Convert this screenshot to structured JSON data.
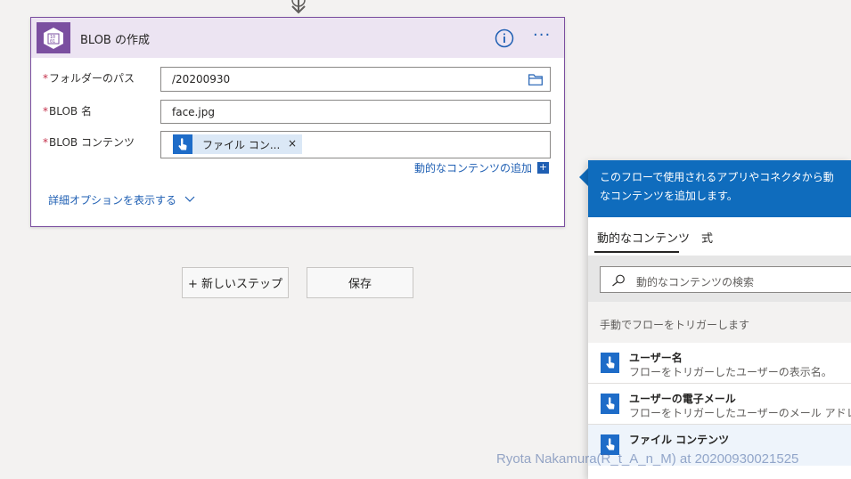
{
  "action_card": {
    "title": "BLOB の作成",
    "icon": "blob-storage-icon",
    "fields": [
      {
        "label": "フォルダーのパス",
        "value": "/20200930",
        "required_mark": "*"
      },
      {
        "label": "BLOB 名",
        "value": "face.jpg",
        "required_mark": "*"
      },
      {
        "label": "BLOB コンテンツ",
        "token_label": "ファイル コン...",
        "token_close": "×",
        "required_mark": "*"
      }
    ],
    "add_dynamic_content": "動的なコンテンツの追加",
    "show_advanced": "詳細オプションを表示する",
    "colors": {
      "accent": "#7b4fa0",
      "header_bg": "#ece4f2",
      "link": "#1f5fb3"
    }
  },
  "buttons": {
    "new_step": "+ 新しいステップ",
    "save": "保存"
  },
  "dynamic_panel": {
    "header_line1": "このフローで使用されるアプリやコネクタから動",
    "header_line2": "なコンテンツを追加します。",
    "tabs": [
      "動的なコンテンツ",
      "式"
    ],
    "search_placeholder": "動的なコンテンツの検索",
    "section_title": "手動でフローをトリガーします",
    "items": [
      {
        "title": "ユーザー名",
        "description": "フローをトリガーしたユーザーの表示名。"
      },
      {
        "title": "ユーザーの電子メール",
        "description": "フローをトリガーしたユーザーのメール アドレ"
      },
      {
        "title": "ファイル コンテンツ",
        "description": ""
      }
    ],
    "colors": {
      "header_bg": "#0f6cbd",
      "item_icon": "#1e6cc8"
    }
  },
  "watermark": "Ryota Nakamura(R_t_A_n_M) at 20200930021525"
}
